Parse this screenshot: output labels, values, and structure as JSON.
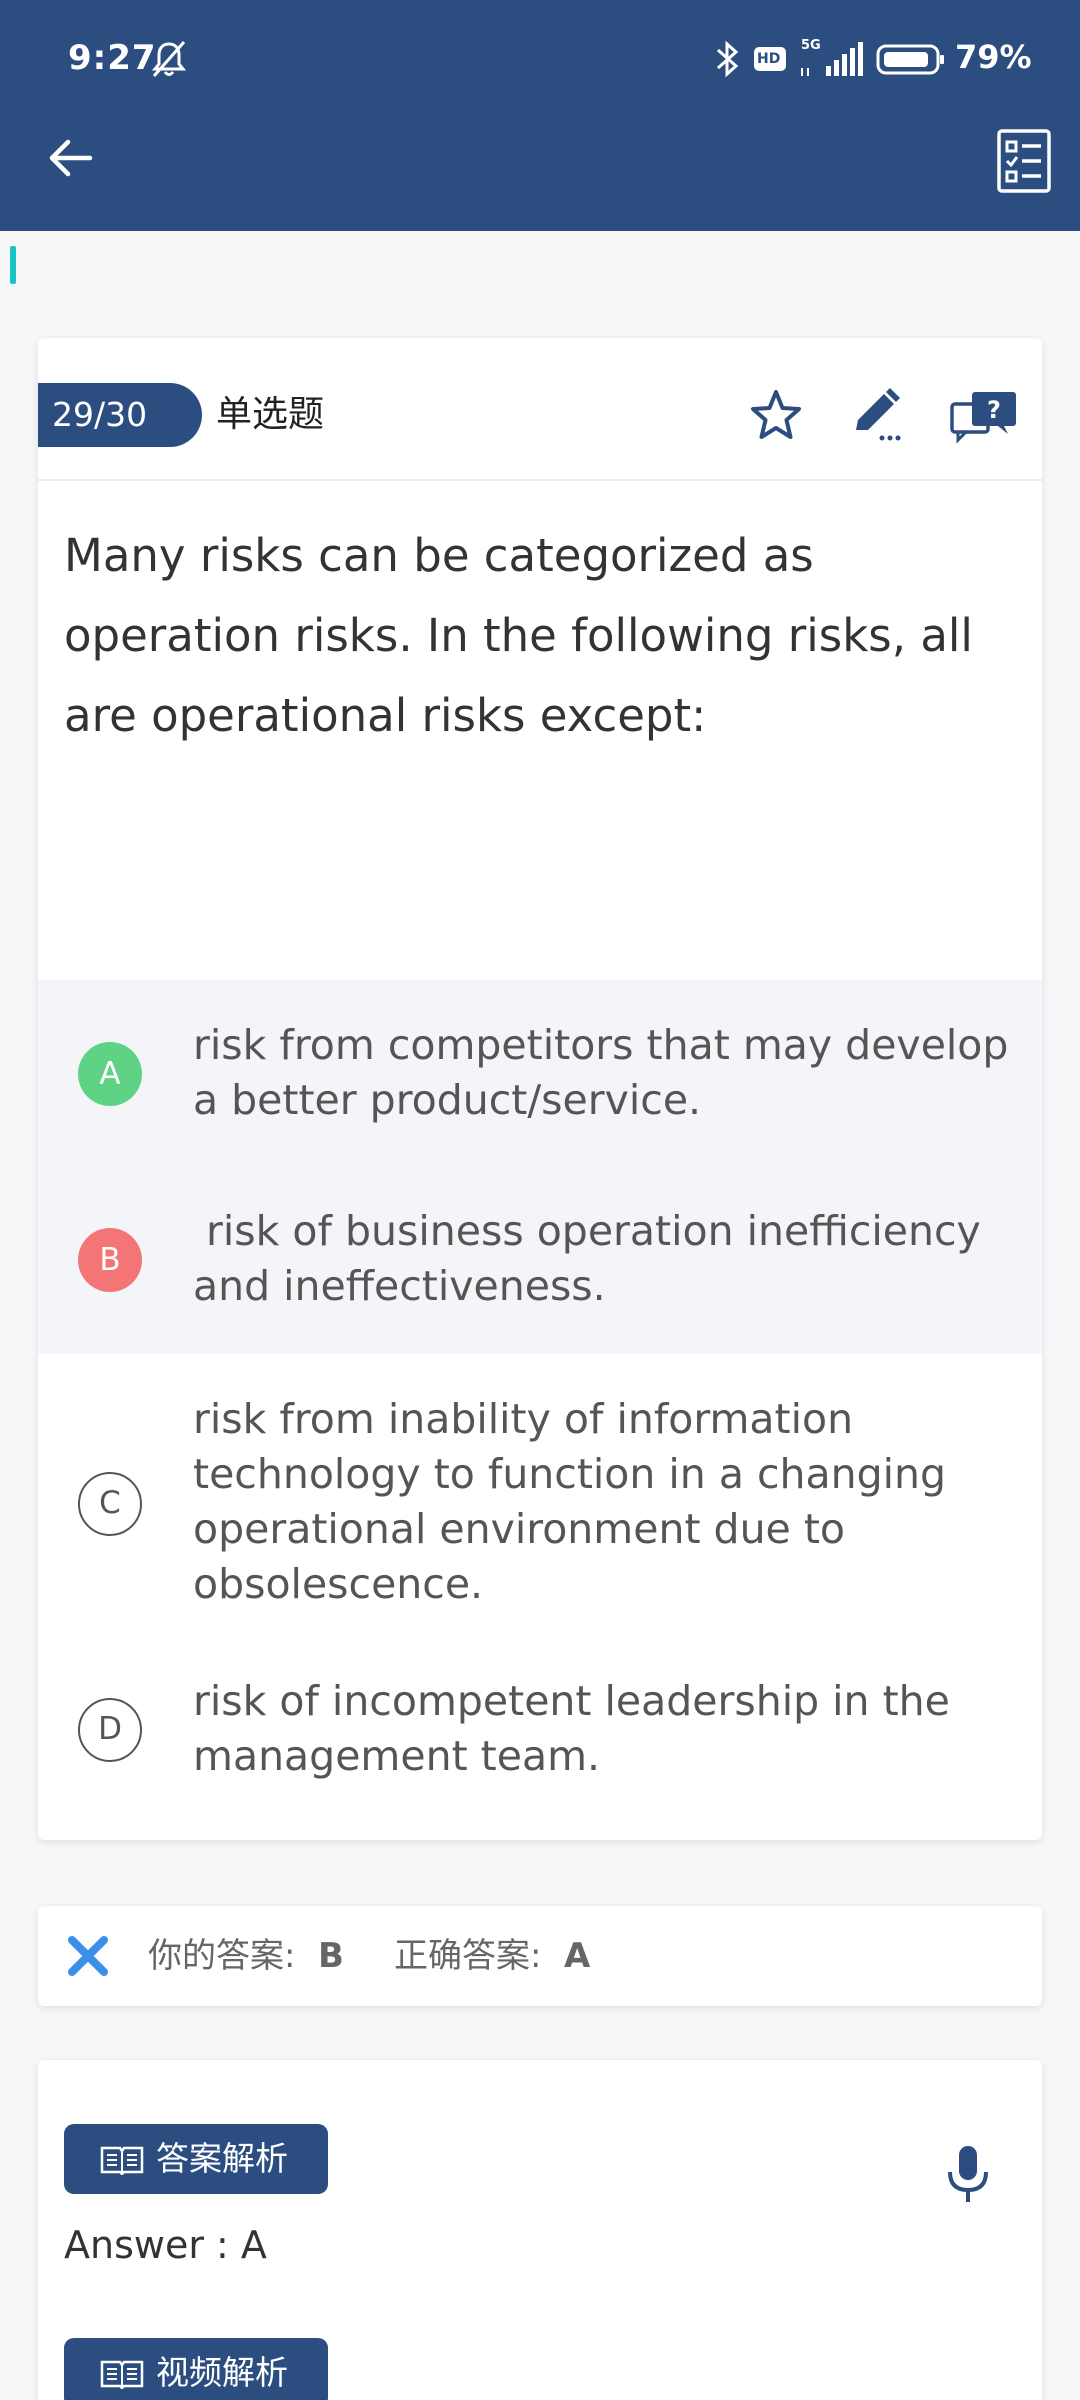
{
  "status_bar": {
    "time": "9:27",
    "network": "5G",
    "battery_percent": "79%",
    "hd_label": "HD"
  },
  "question": {
    "number": "29/30",
    "type": "单选题",
    "text": "Many risks can be categorized as operation risks. In the following risks, all are operational risks except:",
    "options": [
      {
        "letter": "A",
        "text": "risk from competitors that may develop a better product/service.",
        "state": "correct"
      },
      {
        "letter": "B",
        "text": " risk of business operation inefficiency and ineffectiveness.",
        "state": "wrong"
      },
      {
        "letter": "C",
        "text": "risk from inability of information technology to function in a changing operational environment due to obsolescence.",
        "state": "none"
      },
      {
        "letter": "D",
        "text": "risk of incompetent leadership in the management team.",
        "state": "none"
      }
    ]
  },
  "result": {
    "your_answer_label": "你的答案:",
    "your_answer": "B",
    "correct_answer_label": "正确答案:",
    "correct_answer": "A"
  },
  "analysis": {
    "answer_analysis_label": "答案解析",
    "answer_text": "Answer : A",
    "video_analysis_label": "视频解析"
  },
  "colors": {
    "primary": "#2c4d80",
    "correct": "#5fd283",
    "wrong": "#f47575",
    "accent": "#1cc3c3"
  }
}
